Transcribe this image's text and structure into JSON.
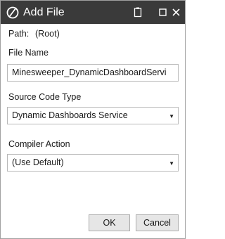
{
  "window": {
    "title": "Add File",
    "icons": [
      "app-logo-icon",
      "clipboard-icon",
      "maximize-icon",
      "close-icon"
    ]
  },
  "path": {
    "label": "Path:",
    "value": "(Root)"
  },
  "file_name": {
    "label": "File Name",
    "value": "Minesweeper_DynamicDashboardServi"
  },
  "source_code_type": {
    "label": "Source Code Type",
    "selected": "Dynamic Dashboards Service"
  },
  "compiler_action": {
    "label": "Compiler Action",
    "selected": "(Use Default)"
  },
  "buttons": {
    "ok": "OK",
    "cancel": "Cancel"
  }
}
